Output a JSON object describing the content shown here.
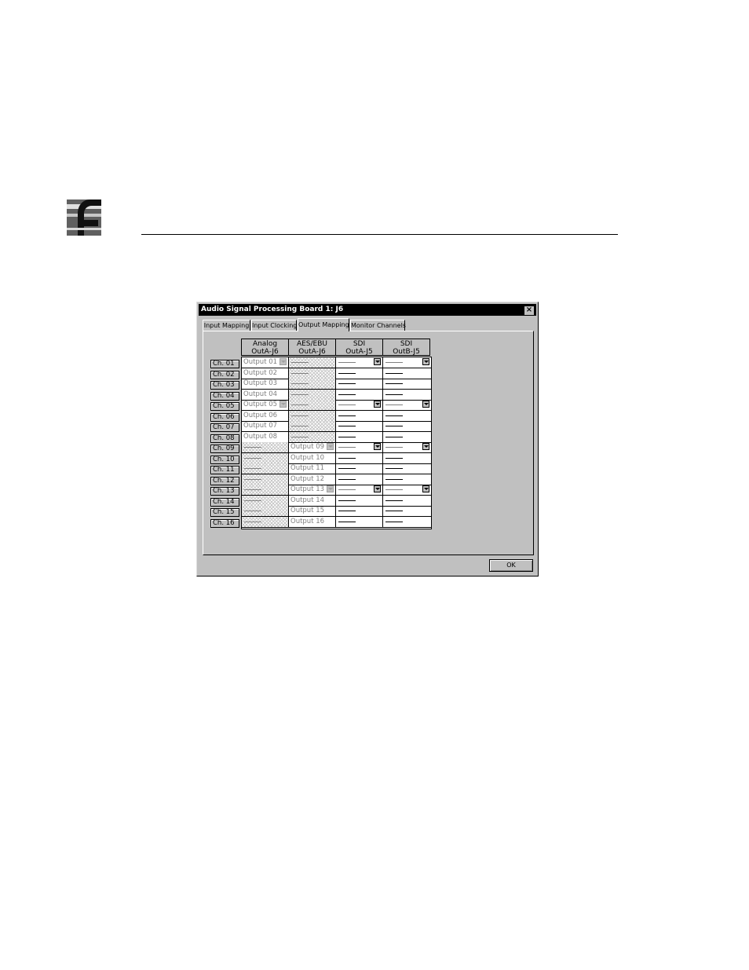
{
  "dialog": {
    "title": "Audio Signal Processing Board 1: J6",
    "close_label": "×",
    "ok_label": "OK"
  },
  "tabs": [
    {
      "label": "Input Mapping",
      "active": false
    },
    {
      "label": "Input Clocking",
      "active": false
    },
    {
      "label": "Output Mapping",
      "active": true
    },
    {
      "label": "Monitor Channels",
      "active": false
    }
  ],
  "columns": [
    {
      "line1": "Analog",
      "line2": "OutA-J6"
    },
    {
      "line1": "AES/EBU",
      "line2": "OutA-J6"
    },
    {
      "line1": "SDI",
      "line2": "OutA-J5"
    },
    {
      "line1": "SDI",
      "line2": "OutB-J5"
    }
  ],
  "rows": [
    {
      "label": "Ch. 01",
      "analog": "Output 01",
      "aes": "",
      "analog_dropdown": true,
      "aes_dropdown": false,
      "sdi_dropdown": true
    },
    {
      "label": "Ch. 02",
      "analog": "Output 02",
      "aes": "",
      "analog_dropdown": false,
      "aes_dropdown": false,
      "sdi_dropdown": false
    },
    {
      "label": "Ch. 03",
      "analog": "Output 03",
      "aes": "",
      "analog_dropdown": false,
      "aes_dropdown": false,
      "sdi_dropdown": false
    },
    {
      "label": "Ch. 04",
      "analog": "Output 04",
      "aes": "",
      "analog_dropdown": false,
      "aes_dropdown": false,
      "sdi_dropdown": false
    },
    {
      "label": "Ch. 05",
      "analog": "Output 05",
      "aes": "",
      "analog_dropdown": true,
      "aes_dropdown": false,
      "sdi_dropdown": true
    },
    {
      "label": "Ch. 06",
      "analog": "Output 06",
      "aes": "",
      "analog_dropdown": false,
      "aes_dropdown": false,
      "sdi_dropdown": false
    },
    {
      "label": "Ch. 07",
      "analog": "Output 07",
      "aes": "",
      "analog_dropdown": false,
      "aes_dropdown": false,
      "sdi_dropdown": false
    },
    {
      "label": "Ch. 08",
      "analog": "Output 08",
      "aes": "",
      "analog_dropdown": false,
      "aes_dropdown": false,
      "sdi_dropdown": false
    },
    {
      "label": "Ch. 09",
      "analog": "",
      "aes": "Output 09",
      "analog_dropdown": false,
      "aes_dropdown": true,
      "sdi_dropdown": true
    },
    {
      "label": "Ch. 10",
      "analog": "",
      "aes": "Output 10",
      "analog_dropdown": false,
      "aes_dropdown": false,
      "sdi_dropdown": false
    },
    {
      "label": "Ch. 11",
      "analog": "",
      "aes": "Output 11",
      "analog_dropdown": false,
      "aes_dropdown": false,
      "sdi_dropdown": false
    },
    {
      "label": "Ch. 12",
      "analog": "",
      "aes": "Output 12",
      "analog_dropdown": false,
      "aes_dropdown": false,
      "sdi_dropdown": false
    },
    {
      "label": "Ch. 13",
      "analog": "",
      "aes": "Output 13",
      "analog_dropdown": false,
      "aes_dropdown": true,
      "sdi_dropdown": true
    },
    {
      "label": "Ch. 14",
      "analog": "",
      "aes": "Output 14",
      "analog_dropdown": false,
      "aes_dropdown": false,
      "sdi_dropdown": false
    },
    {
      "label": "Ch. 15",
      "analog": "",
      "aes": "Output 15",
      "analog_dropdown": false,
      "aes_dropdown": false,
      "sdi_dropdown": false
    },
    {
      "label": "Ch. 16",
      "analog": "",
      "aes": "Output 16",
      "analog_dropdown": false,
      "aes_dropdown": false,
      "sdi_dropdown": false
    }
  ],
  "colors": {
    "dialog_face": "#c0c0c0",
    "title_bar": "#000000",
    "disabled_text": "#808080"
  }
}
